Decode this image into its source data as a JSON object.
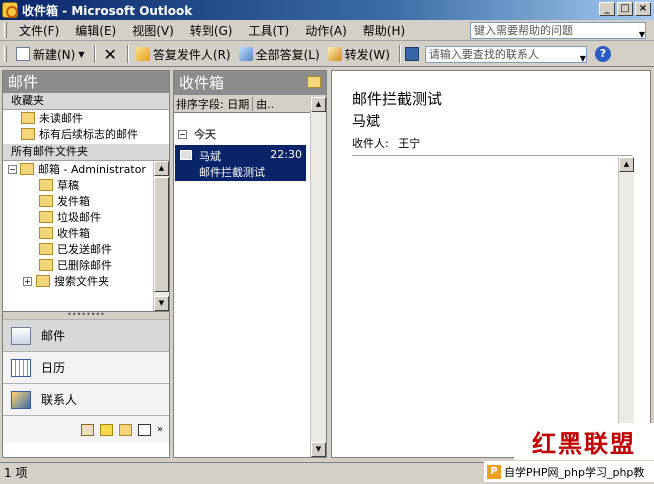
{
  "window": {
    "title": "收件箱 - Microsoft Outlook",
    "controls": {
      "minimize": "_",
      "maximize": "□",
      "close": "×"
    }
  },
  "menu": {
    "items": [
      "文件(F)",
      "编辑(E)",
      "视图(V)",
      "转到(G)",
      "工具(T)",
      "动作(A)",
      "帮助(H)"
    ],
    "help_placeholder": "键入需要帮助的问题"
  },
  "toolbar": {
    "new_label": "新建(N)",
    "reply_label": "答复发件人(R)",
    "reply_all_label": "全部答复(L)",
    "forward_label": "转发(W)",
    "contact_placeholder": "请输入要查找的联系人",
    "help_symbol": "?"
  },
  "nav": {
    "title": "邮件",
    "favorites_header": "收藏夹",
    "favorites": [
      "未读邮件",
      "标有后续标志的邮件"
    ],
    "all_folders_header": "所有邮件文件夹",
    "mailbox": "邮箱 - Administrator",
    "folders": [
      "草稿",
      "发件箱",
      "垃圾邮件",
      "收件箱",
      "已发送邮件",
      "已删除邮件",
      "搜索文件夹"
    ],
    "buttons": {
      "mail": "邮件",
      "calendar": "日历",
      "contacts": "联系人"
    }
  },
  "list": {
    "title": "收件箱",
    "arrange_by": "排序字段: 日期",
    "sort_label": "由..",
    "group": "今天",
    "message": {
      "from": "马斌",
      "time": "22:30",
      "subject": "邮件拦截测试"
    }
  },
  "reader": {
    "subject": "邮件拦截测试",
    "from": "马斌",
    "to_label": "收件人:",
    "to_value": "王宁"
  },
  "status": {
    "text": "1 项"
  },
  "watermarks": {
    "main": "红黑联盟",
    "secondary": "自学PHP网_php学习_php教"
  }
}
